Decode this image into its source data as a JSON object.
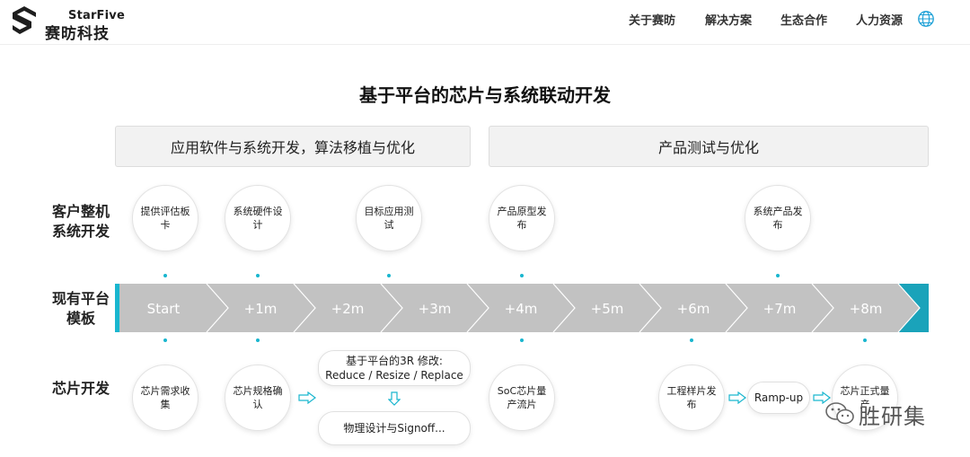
{
  "header": {
    "brand_en": "StarFive",
    "brand_cn": "赛昉科技",
    "nav": [
      "关于赛昉",
      "解决方案",
      "生态合作",
      "人力资源"
    ],
    "globe_icon": "globe-icon"
  },
  "title": "基于平台的芯片与系统联动开发",
  "phases": {
    "left": "应用软件与系统开发，算法移植与优化",
    "right": "产品测试与优化"
  },
  "rows": {
    "customer": "客户整机系统开发",
    "platform": "现有平台模板",
    "chip": "芯片开发"
  },
  "customer_milestones": [
    "提供评估板卡",
    "系统硬件设计",
    "目标应用测试",
    "产品原型发布",
    "系统产品发布"
  ],
  "timeline": [
    "Start",
    "+1m",
    "+2m",
    "+3m",
    "+4m",
    "+5m",
    "+6m",
    "+7m",
    "+8m"
  ],
  "chip_milestones": {
    "collect": "芯片需求收集",
    "spec": "芯片规格确认",
    "mod_title": "基于平台的3R 修改:",
    "mod_items": "Reduce / Resize / Replace",
    "signoff": "物理设计与Signoff...",
    "soc": "SoC芯片量产流片",
    "sample": "工程样片发布",
    "rampup": "Ramp-up",
    "mass": "芯片正式量产"
  },
  "watermark": "胜研集",
  "colors": {
    "accent": "#19b6cf",
    "timeline_gray": "#c2c2c2",
    "timeline_end": "#1aa3ba"
  }
}
